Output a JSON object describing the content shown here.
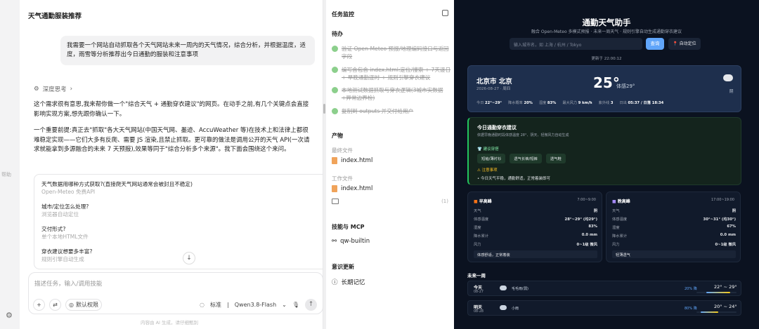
{
  "sidebar_left": {
    "label": "帮助"
  },
  "chat": {
    "title": "天气通勤服装推荐",
    "user_message": "我需要一个网站自动抓取各个天气网站未来一周内的天气情况，综合分析，并根据温度，适度，雨雪等分析推荐出今日通勤的服装和注意事项",
    "thinking_label": "深度思考",
    "para1": "这个需求很有意思,我来帮你做一个\"综合天气 + 通勤穿衣建议\"的网页。在动手之前,有几个关键点会直接影响实现方案,想先跟你确认一下。",
    "para2": "一个重要前提:真正去\"抓取\"各大天气网站(中国天气网、墨迹、AccuWeather 等)在技术上和法律上都很难稳定实现——它们大多有反爬、需要 JS 渲染,且禁止抓取。更可靠的做法是调用公开的天气 API(一次请求就能拿到多源融合的未来 7 天预报),效果等同于\"综合分析多个来源\"。我下面会围绕这个来问。",
    "questions": [
      {
        "q": "天气数据用哪种方式获取?(直接爬天气网站通常会被封且不稳定)",
        "a": "Open-Meteo 免费API"
      },
      {
        "q": "城市/定位怎么处理?",
        "a": "浏览器自动定位"
      },
      {
        "q": "交付形式?",
        "a": "单个本地HTML文件"
      },
      {
        "q": "穿衣建议想要多丰富?",
        "a": "规则引擎自动生成"
      }
    ],
    "input_placeholder": "描述任务，输入/调用技能",
    "default_permission": "默认权限",
    "mode": "标准",
    "model": "Qwen3.8-Flash",
    "footnote": "内容由 AI 生成，请仔细甄别"
  },
  "tasks": {
    "title": "任务监控",
    "todo_label": "待办",
    "todos": [
      "验证 Open-Meteo 预报/地理编码接口与返回字段",
      "编写含包含 index.html:定位/搜索 + 7天逐日 + 早晚通勤逐时 + 规则引擎穿衣建议",
      "本地测试数据抓取与穿衣逻辑(3城市实数据+异常边界检)",
      "复制到 outputs 并交付给用户"
    ],
    "artifacts_label": "产物",
    "latest_file_label": "最终文件",
    "latest_file": "index.html",
    "work_file_label": "工作文件",
    "work_file": "index.html",
    "folder_count": "(1)",
    "skills_label": "技能与 MCP",
    "skill": "qw-builtin",
    "memory_label": "意识更新",
    "memory": "长期记忆"
  },
  "dashboard": {
    "title": "通勤天气助手",
    "subtitle": "融合 Open-Meteo 多模式预报 · 未来一周天气 · 规则引擎自动生成通勤穿衣建议",
    "search_placeholder": "输入城市名，如 上海 / 杭州 / Tokyo",
    "query_button": "查询",
    "locate_button": "📍 自动定位",
    "updated": "更新于 22:00:12",
    "now": {
      "city": "北京市 北京",
      "date": "2026-08-27 · 周四",
      "temp": "25°",
      "feels": "体感29°",
      "condition": "阴",
      "stats": [
        {
          "k": "今日",
          "v": "22°~29°"
        },
        {
          "k": "降水概率",
          "v": "20%"
        },
        {
          "k": "湿度",
          "v": "83%"
        },
        {
          "k": "最大风力",
          "v": "9 km/h"
        },
        {
          "k": "紫外线",
          "v": "3"
        },
        {
          "k": "日出",
          "v": "05:37 / 日落 18:34"
        }
      ]
    },
    "advice": {
      "title": "今日通勤穿衣建议",
      "subtitle": "依据早晚通勤时段体感温度 28°、阴天、轻微风力自动生成",
      "clothing_head": "👕 建议穿搭",
      "chips": [
        "短袖/薄衬衫",
        "透气长裤/短裤",
        "透气鞋"
      ],
      "attention_head": "⚠ 注意事项",
      "tip": "今日天气平稳，通勤舒适，正常着装即可"
    },
    "peaks": [
      {
        "title": "早高峰",
        "time": "7:00~9:00",
        "rows": [
          {
            "k": "天气",
            "v": "阴"
          },
          {
            "k": "体感温度",
            "v": "28°~29° (均29°)"
          },
          {
            "k": "湿度",
            "v": "83%"
          },
          {
            "k": "降水累计",
            "v": "0.0 mm"
          },
          {
            "k": "风力",
            "v": "0~1级 微风"
          }
        ],
        "tip": "体感舒适，正常着装"
      },
      {
        "title": "晚高峰",
        "time": "17:00~19:00",
        "rows": [
          {
            "k": "天气",
            "v": "阴"
          },
          {
            "k": "体感温度",
            "v": "30°~31° (均30°)"
          },
          {
            "k": "湿度",
            "v": "67%"
          },
          {
            "k": "降水累计",
            "v": "0.0 mm"
          },
          {
            "k": "风力",
            "v": "0~1级 微风"
          }
        ],
        "tip": "轻薄透气"
      }
    ],
    "week_title": "未来一周",
    "days": [
      {
        "name": "今天",
        "date": "08-27",
        "cond": "毛毛雨(弱)",
        "pop": "20% 降",
        "temp": "22° ~ 29°",
        "lo": 0.25,
        "hi": 0.85
      },
      {
        "name": "明天",
        "date": "08-28",
        "cond": "小雨",
        "pop": "80% 降",
        "temp": "20° ~ 24°",
        "lo": 0.1,
        "hi": 0.55
      }
    ]
  }
}
